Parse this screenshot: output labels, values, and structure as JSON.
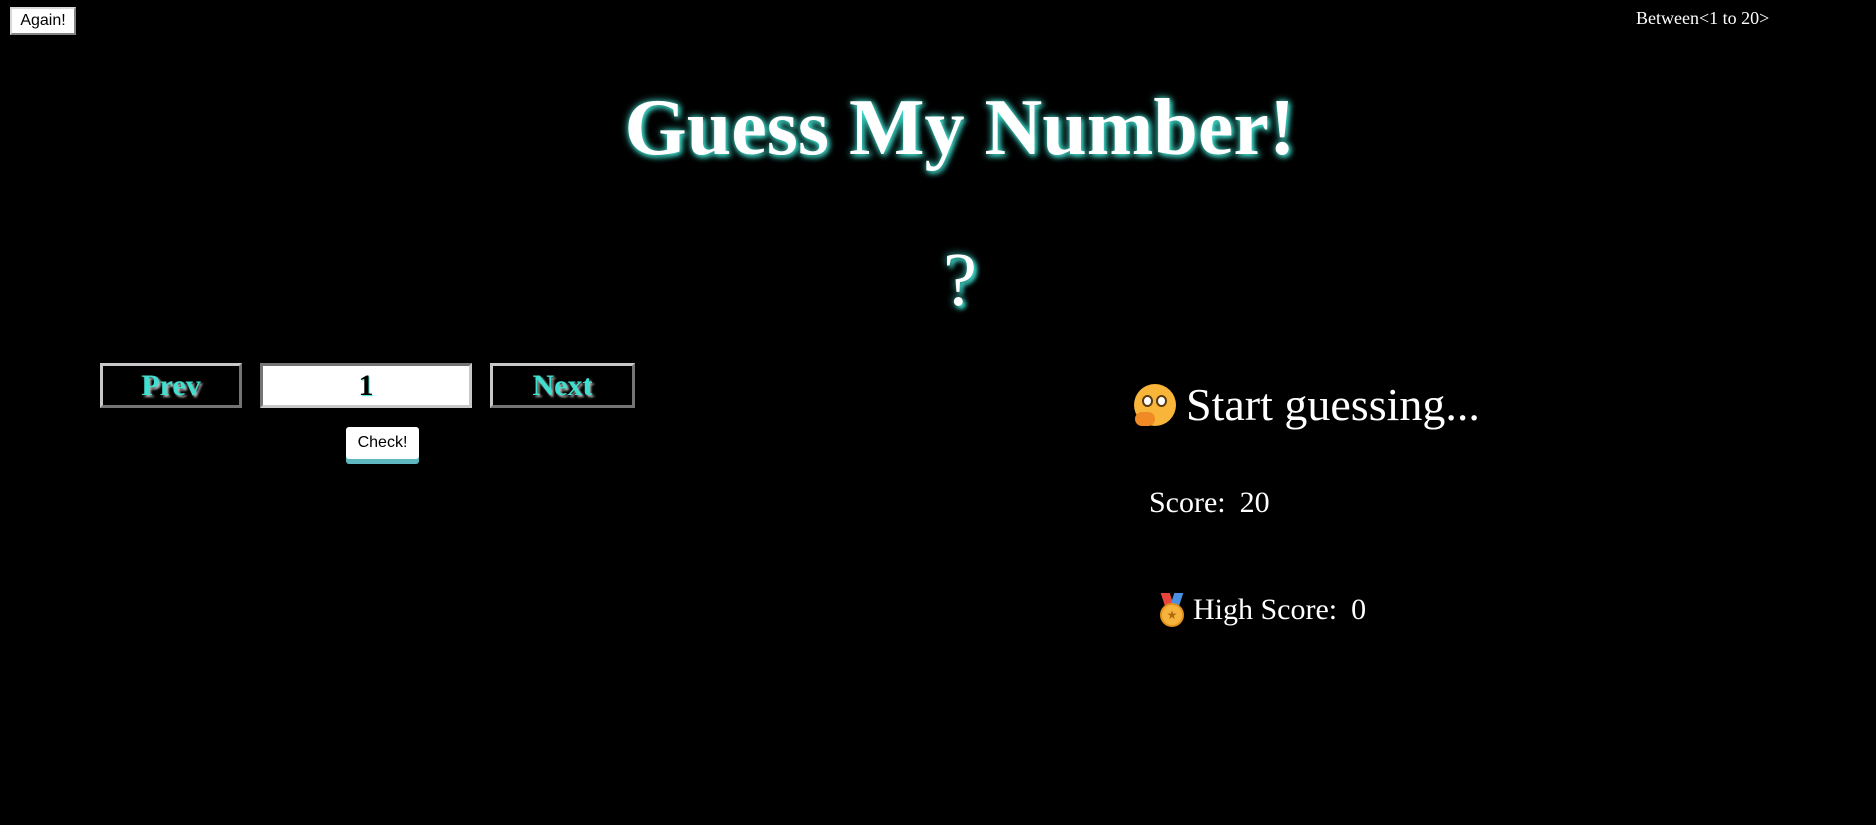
{
  "header": {
    "again_label": "Again!",
    "range_text": "Between<1 to 20>"
  },
  "title": "Guess My Number!",
  "secret_display": "?",
  "controls": {
    "prev_label": "Prev",
    "guess_value": "1",
    "next_label": "Next",
    "check_label": "Check!"
  },
  "status": {
    "message_icon": "thinking-face-icon",
    "message": "Start guessing...",
    "score_label": "Score:",
    "score_value": "20",
    "highscore_icon": "medal-icon",
    "highscore_label": "High Score:",
    "highscore_value": "0"
  },
  "colors": {
    "background": "#000000",
    "accent": "#40e0d0",
    "text": "#ffffff"
  }
}
